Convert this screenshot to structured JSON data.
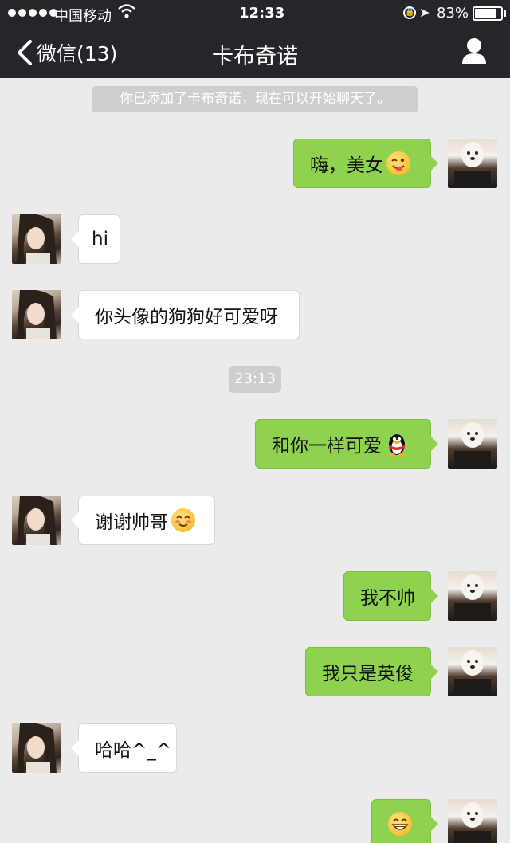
{
  "status_bar": {
    "carrier": "中国移动",
    "time": "12:33",
    "battery_percent": "83%",
    "battery_level": 0.83
  },
  "nav": {
    "back_label": "微信(13)",
    "title": "卡布奇诺"
  },
  "notice": {
    "added_text": "你已添加了卡布奇诺，现在可以开始聊天了。",
    "timestamp": "23:13"
  },
  "messages": [
    {
      "from": "me",
      "text": "嗨，美女",
      "emoji": "wink-tongue-emoji"
    },
    {
      "from": "her",
      "text": "hi"
    },
    {
      "from": "her",
      "text": "你头像的狗狗好可爱呀"
    },
    {
      "from": "me",
      "text": "和你一样可爱",
      "emoji": "qq-penguin-emoji"
    },
    {
      "from": "her",
      "text": "谢谢帅哥",
      "emoji": "shy-smile-emoji"
    },
    {
      "from": "me",
      "text": "我不帅"
    },
    {
      "from": "me",
      "text": "我只是英俊"
    },
    {
      "from": "her",
      "text": "哈哈^_^"
    },
    {
      "from": "me",
      "text": "",
      "emoji": "grin-emoji"
    }
  ],
  "colors": {
    "nav_bg": "#25252a",
    "chat_bg": "#ebebeb",
    "bubble_out": "#8fd24f",
    "bubble_in": "#ffffff"
  }
}
